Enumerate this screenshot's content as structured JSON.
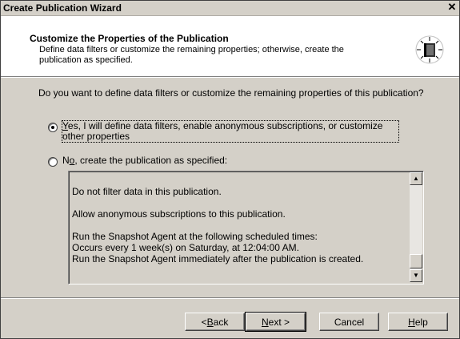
{
  "window": {
    "title": "Create Publication Wizard",
    "close_glyph": "✕"
  },
  "header": {
    "title": "Customize the Properties of the Publication",
    "description": "Define data filters or customize the remaining properties; otherwise, create the publication as specified."
  },
  "question": "Do you want to define data filters or customize the remaining properties of this publication?",
  "options": [
    {
      "mnemonic": "Y",
      "rest": "es, I will define data filters, enable anonymous subscriptions, or customize other properties",
      "checked": true
    },
    {
      "prefix": "N",
      "mnemonic": "o",
      "rest": ", create the publication as specified:",
      "checked": false
    }
  ],
  "summary": {
    "lines": [
      "Do not filter data in this publication.",
      "Allow anonymous subscriptions to this publication.",
      "Run the Snapshot Agent at the following scheduled times:",
      "Occurs every 1 week(s) on Saturday, at 12:04:00 AM.",
      "Run the Snapshot Agent immediately after the publication is created."
    ]
  },
  "buttons": {
    "back": {
      "prefix": "< ",
      "mnemonic": "B",
      "rest": "ack"
    },
    "next": {
      "mnemonic": "N",
      "rest": "ext >"
    },
    "cancel": "Cancel",
    "help": {
      "mnemonic": "H",
      "rest": "elp"
    }
  }
}
